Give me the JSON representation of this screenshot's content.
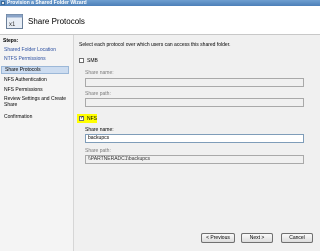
{
  "window": {
    "title": "Provision a Shared Folder Wizard"
  },
  "header": {
    "title": "Share Protocols",
    "icon": "wizard-icon"
  },
  "sidebar": {
    "label": "Steps:",
    "items": [
      {
        "label": "Shared Folder Location"
      },
      {
        "label": "NTFS Permissions"
      },
      {
        "label": "Share Protocols"
      },
      {
        "label": "NFS Authentication"
      },
      {
        "label": "NFS Permissions"
      },
      {
        "label": "Review Settings and Create Share"
      },
      {
        "label": "Confirmation"
      }
    ]
  },
  "main": {
    "intro": "Select each protocol over which users can access this shared folder.",
    "smb": {
      "label": "SMB",
      "checked": false,
      "share_name_label": "Share name:",
      "share_name": "",
      "share_path_label": "Share path:",
      "share_path": ""
    },
    "nfs": {
      "label": "NFS",
      "checked": true,
      "share_name_label": "Share name:",
      "share_name": "backupcs",
      "share_path_label": "Share path:",
      "share_path": "\\\\PARTNERADC1\\backupcs"
    }
  },
  "buttons": {
    "previous": "< Previous",
    "next": "Next >",
    "cancel": "Cancel"
  },
  "colors": {
    "titlebar": "#4c7fb8",
    "active_step": "#ccdcf0",
    "link": "#2a4ea0",
    "highlight": "#ffff00"
  }
}
